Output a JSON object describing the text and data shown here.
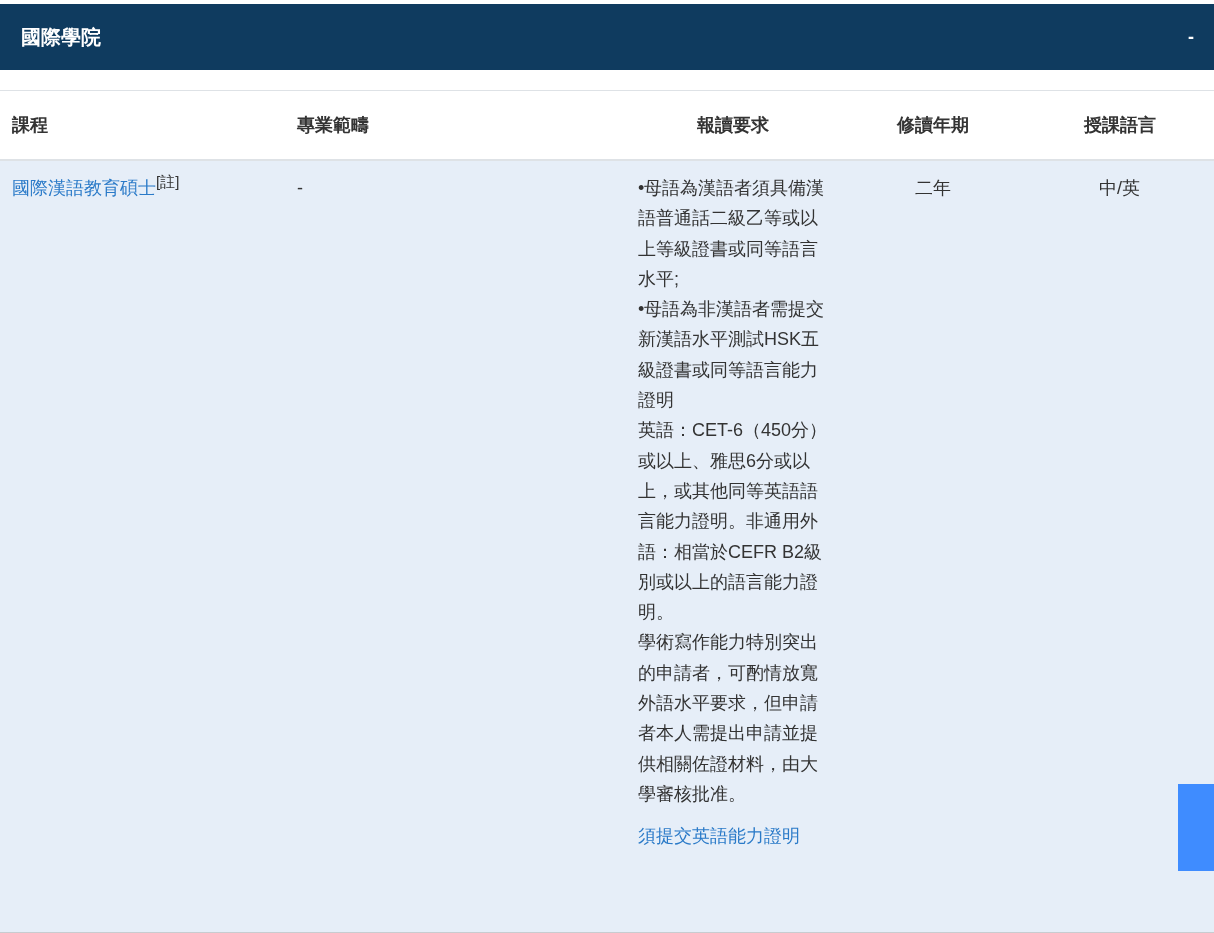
{
  "section": {
    "title": "國際學院",
    "toggle": "-"
  },
  "table": {
    "columns": [
      "課程",
      "專業範疇",
      "報讀要求",
      "修讀年期",
      "授課語言"
    ],
    "rows": [
      {
        "course": "國際漢語教育碩士$^{[註]}$",
        "field": "-",
        "requirements": [
          "•母語為漢語者須具備漢語普通話二級乙等或以上等級證書或同等語言水平;",
          "•母語為非漢語者需提交新漢語水平測試HSK五級證書或同等語言能力證明",
          "英語：CET-6（450分）或以上、雅思6分或以上，或其他同等英語語言能力證明。非通用外語：相當於CEFR B2級別或以上的語言能力證明。",
          "學術寫作能力特別突出的申請者，可酌情放寬外語水平要求，但申請者本人需提出申請並提供相關佐證材料，由大學審核批准。"
        ],
        "requirement_link": "須提交英語能力證明",
        "duration": "二年",
        "language": "中/英"
      }
    ]
  }
}
